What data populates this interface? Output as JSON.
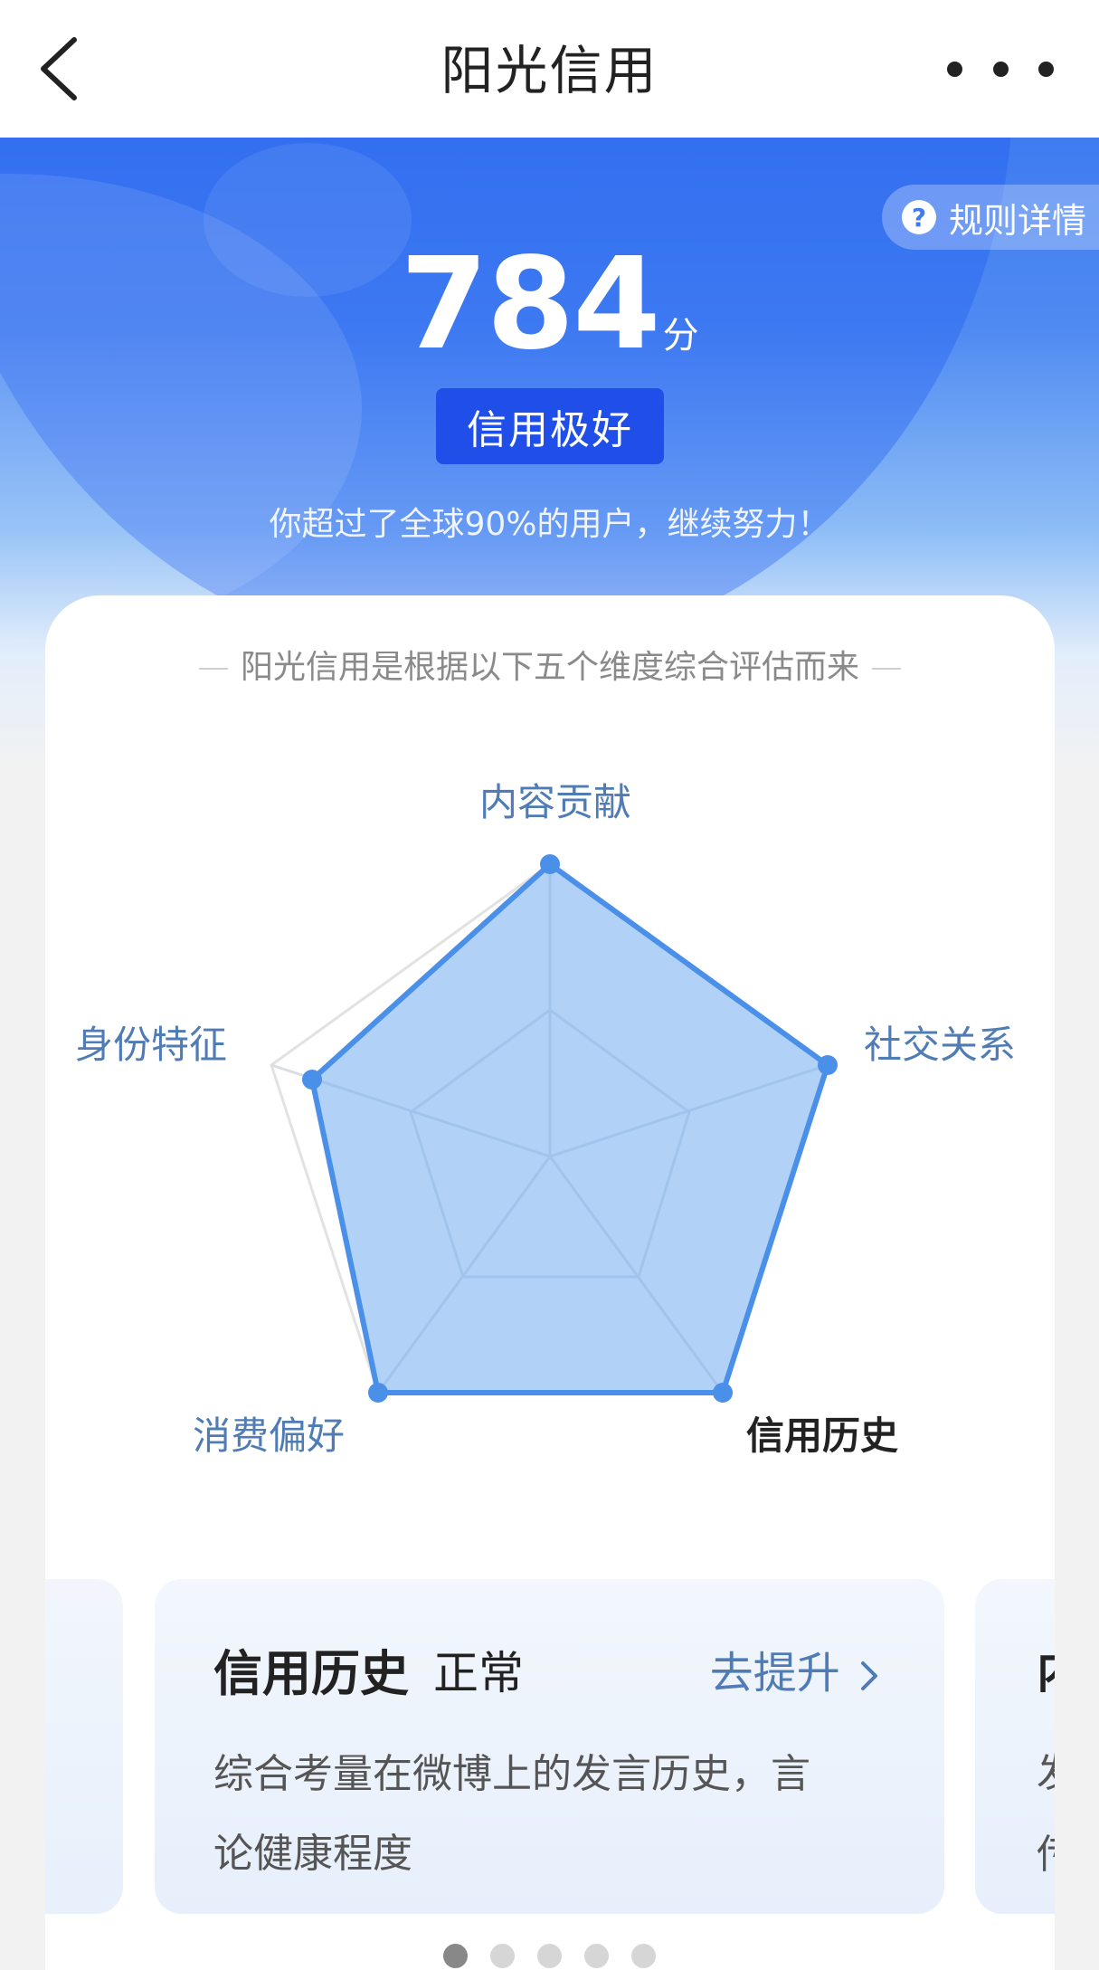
{
  "nav": {
    "title": "阳光信用",
    "back_icon": "chevron-left-icon",
    "more_icon": "more-horizontal-icon"
  },
  "hero": {
    "rules_label": "规则详情",
    "rules_icon": "question-circle-icon",
    "score": "784",
    "score_unit": "分",
    "level": "信用极好",
    "exceed_text": "你超过了全球90%的用户，继续努力！"
  },
  "card": {
    "subtitle": "阳光信用是根据以下五个维度综合评估而来",
    "radar": {
      "labels": {
        "content": "内容贡献",
        "social": "社交关系",
        "history": "信用历史",
        "consumption": "消费偏好",
        "identity": "身份特征"
      },
      "active": "信用历史"
    },
    "slide": {
      "title": "信用历史",
      "status": "正常",
      "link": "去提升",
      "desc_line1": "综合考量在微博上的发言历史，言",
      "desc_line2": "论健康程度"
    },
    "slide_next_peek": {
      "title": "内",
      "line1": "发",
      "line2": "传"
    },
    "pagination": {
      "count": 5,
      "active_index": 0
    }
  },
  "colors": {
    "accent": "#3d7cf1",
    "badge": "#1f4fe8",
    "radar_fill": "#aed0f7",
    "radar_stroke": "#4a90e8",
    "label": "#4f7cb5"
  }
}
